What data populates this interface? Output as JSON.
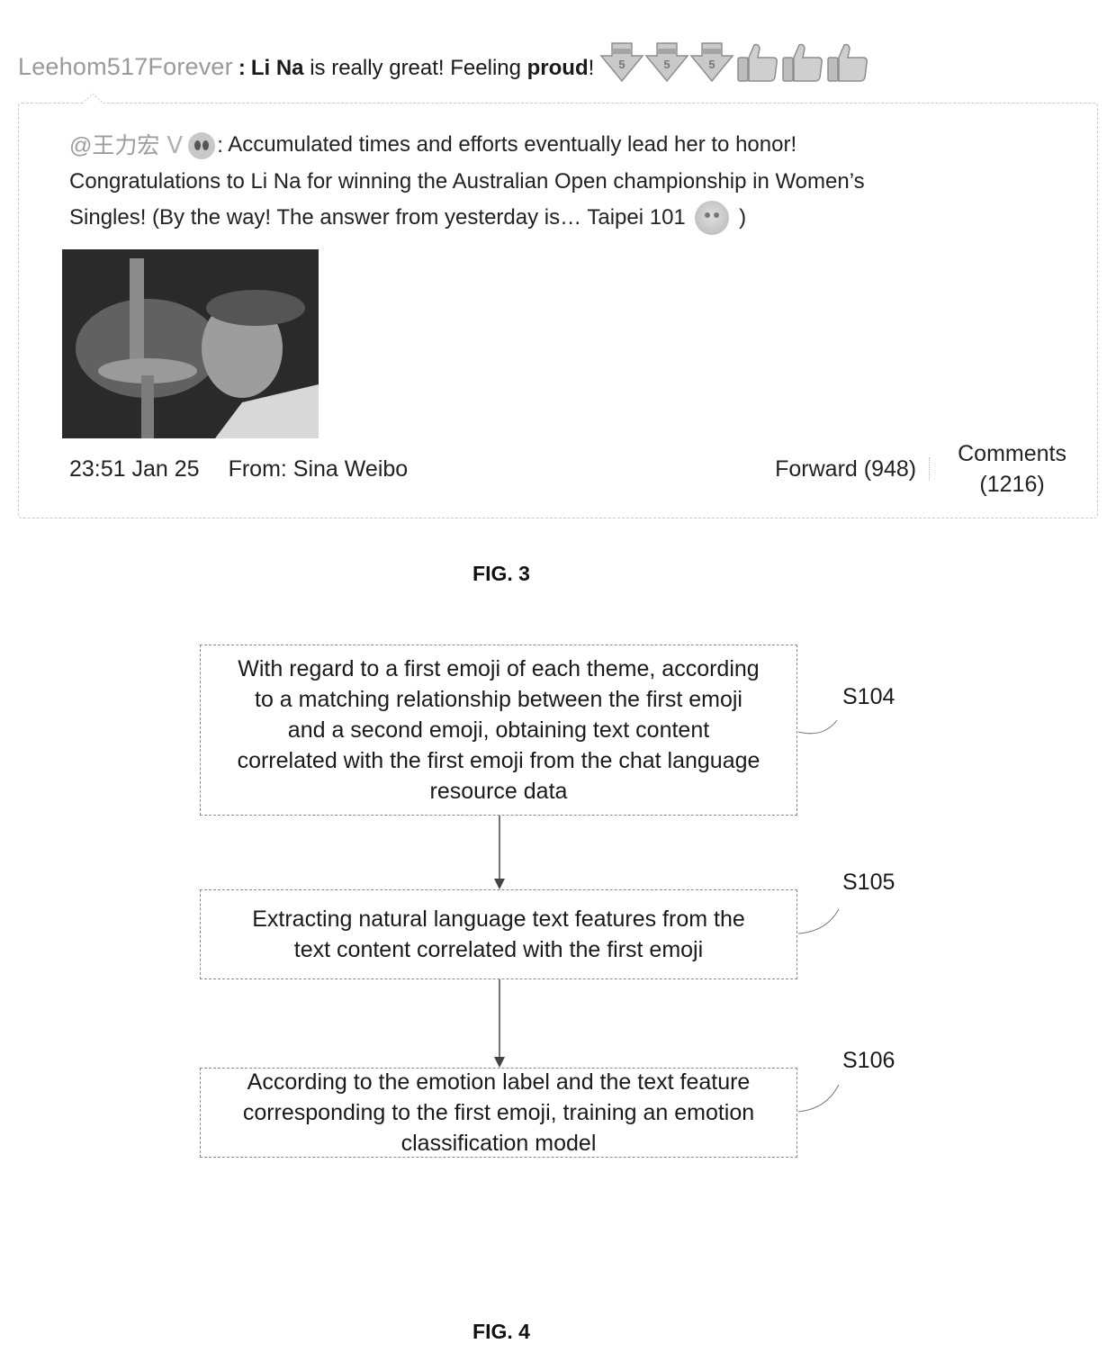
{
  "fig3": {
    "post": {
      "username": "Leehom517Forever",
      "separator": ":",
      "text_parts": [
        {
          "text": "Li Na",
          "bold": true
        },
        {
          "text": " is really great! Feeling ",
          "bold": false
        },
        {
          "text": "proud",
          "bold": true
        },
        {
          "text": "!",
          "bold": false
        }
      ],
      "emojis": [
        "medal-5-icon",
        "medal-5-icon",
        "medal-5-icon",
        "thumbs-up-icon",
        "thumbs-up-icon",
        "thumbs-up-icon"
      ]
    },
    "quoted_post": {
      "mention": "@王力宏",
      "verified_badge": "V",
      "separator": ":",
      "line1": "Accumulated times and efforts eventually lead her to honor!",
      "line2": "Congratulations to Li Na for winning the Australian Open championship in Women’s",
      "line3_before_emoji": "Singles! (By the way! The answer from yesterday is… Taipei 101",
      "line3_after_emoji": ")",
      "image_alt": "Li Na holding trophy",
      "timestamp": "23:51 Jan 25",
      "source": "From: Sina Weibo",
      "forward_label": "Forward (948)",
      "comments_label_line1": "Comments",
      "comments_label_line2": "(1216)"
    },
    "caption": "FIG. 3"
  },
  "fig4": {
    "steps": [
      {
        "id": "S104",
        "lines": [
          "With regard to a first emoji of each theme, according",
          "to a matching relationship between the first emoji",
          "and a second emoji, obtaining text content",
          "correlated with the first emoji from the chat language",
          "resource data"
        ]
      },
      {
        "id": "S105",
        "lines": [
          "Extracting natural language text features from the",
          "text content correlated with the first emoji"
        ]
      },
      {
        "id": "S106",
        "lines": [
          "According to the emotion label and the text feature",
          "corresponding to the first emoji, training an emotion",
          "classification model"
        ]
      }
    ],
    "caption": "FIG. 4"
  }
}
